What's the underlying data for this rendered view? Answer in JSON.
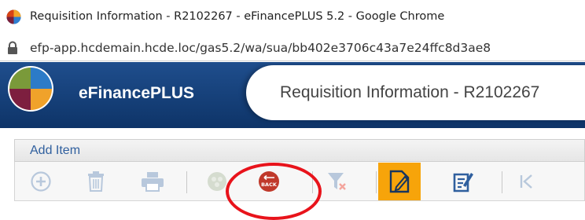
{
  "browser": {
    "window_title": "Requisition Information - R2102267 - eFinancePLUS 5.2 - Google Chrome",
    "url": "efp-app.hcdemain.hcde.loc/gas5.2/wa/sua/bb402e3706c43a7e24ffc8d3ae8"
  },
  "app": {
    "brand": "eFinancePLUS",
    "page_title": "Requisition Information - R2102267"
  },
  "tabs": {
    "active": "Add Item"
  },
  "toolbar": {
    "back_label": "BACK",
    "buttons": [
      {
        "icon": "add-circle-icon",
        "enabled": false
      },
      {
        "icon": "trash-icon",
        "enabled": false
      },
      {
        "icon": "printer-icon",
        "enabled": false
      },
      {
        "icon": "options-icon",
        "enabled": false
      },
      {
        "icon": "back-icon",
        "enabled": true
      },
      {
        "icon": "filter-clear-icon",
        "enabled": false
      },
      {
        "icon": "edit-document-icon",
        "enabled": true,
        "highlighted": true
      },
      {
        "icon": "notepad-edit-icon",
        "enabled": true
      },
      {
        "icon": "first-record-icon",
        "enabled": false
      }
    ]
  },
  "colors": {
    "header_blue": "#1f4e8d",
    "highlight_orange": "#f7a40a",
    "back_red": "#c0392b",
    "annotation_red": "#e8131b",
    "link_blue": "#2f5f9e"
  }
}
